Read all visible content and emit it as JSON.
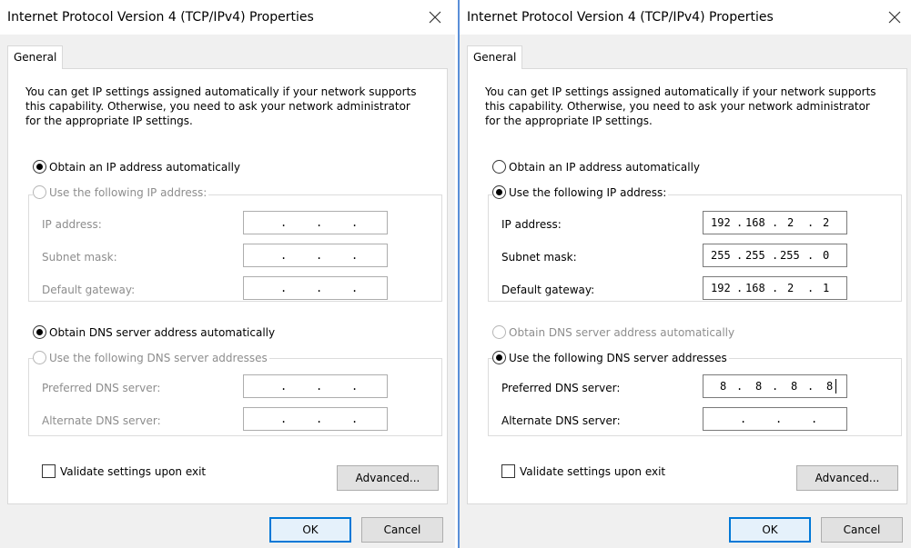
{
  "dialogs": [
    {
      "title": "Internet Protocol Version 4 (TCP/IPv4) Properties",
      "tab_label": "General",
      "intro": "You can get IP settings assigned automatically if your network supports this capability. Otherwise, you need to ask your network administrator for the appropriate IP settings.",
      "ip_mode": {
        "auto_label": "Obtain an IP address automatically",
        "manual_label": "Use the following IP address:",
        "selected": "auto"
      },
      "ip_fields": [
        {
          "label": "IP address:",
          "octets": [
            "",
            "",
            "",
            ""
          ]
        },
        {
          "label": "Subnet mask:",
          "octets": [
            "",
            "",
            "",
            ""
          ]
        },
        {
          "label": "Default gateway:",
          "octets": [
            "",
            "",
            "",
            ""
          ]
        }
      ],
      "dns_mode": {
        "auto_label": "Obtain DNS server address automatically",
        "manual_label": "Use the following DNS server addresses",
        "selected": "auto"
      },
      "dns_fields": [
        {
          "label": "Preferred DNS server:",
          "octets": [
            "",
            "",
            "",
            ""
          ]
        },
        {
          "label": "Alternate DNS server:",
          "octets": [
            "",
            "",
            "",
            ""
          ]
        }
      ],
      "validate_label": "Validate settings upon exit",
      "validate_checked": false,
      "advanced_label": "Advanced...",
      "ok_label": "OK",
      "cancel_label": "Cancel"
    },
    {
      "title": "Internet Protocol Version 4 (TCP/IPv4) Properties",
      "tab_label": "General",
      "intro": "You can get IP settings assigned automatically if your network supports this capability. Otherwise, you need to ask your network administrator for the appropriate IP settings.",
      "ip_mode": {
        "auto_label": "Obtain an IP address automatically",
        "manual_label": "Use the following IP address:",
        "selected": "manual"
      },
      "ip_fields": [
        {
          "label": "IP address:",
          "octets": [
            "192",
            "168",
            "2",
            "2"
          ]
        },
        {
          "label": "Subnet mask:",
          "octets": [
            "255",
            "255",
            "255",
            "0"
          ]
        },
        {
          "label": "Default gateway:",
          "octets": [
            "192",
            "168",
            "2",
            "1"
          ]
        }
      ],
      "dns_mode": {
        "auto_label": "Obtain DNS server address automatically",
        "manual_label": "Use the following DNS server addresses",
        "selected": "manual"
      },
      "dns_fields": [
        {
          "label": "Preferred DNS server:",
          "octets": [
            "8",
            "8",
            "8",
            "8"
          ]
        },
        {
          "label": "Alternate DNS server:",
          "octets": [
            "",
            "",
            "",
            ""
          ]
        }
      ],
      "validate_label": "Validate settings upon exit",
      "validate_checked": false,
      "advanced_label": "Advanced...",
      "ok_label": "OK",
      "cancel_label": "Cancel"
    }
  ],
  "icons": {
    "close": "close-icon"
  },
  "colors": {
    "default_button_border": "#0078d7",
    "divider": "#5a8fd8",
    "disabled_text": "#8d8d8d"
  }
}
